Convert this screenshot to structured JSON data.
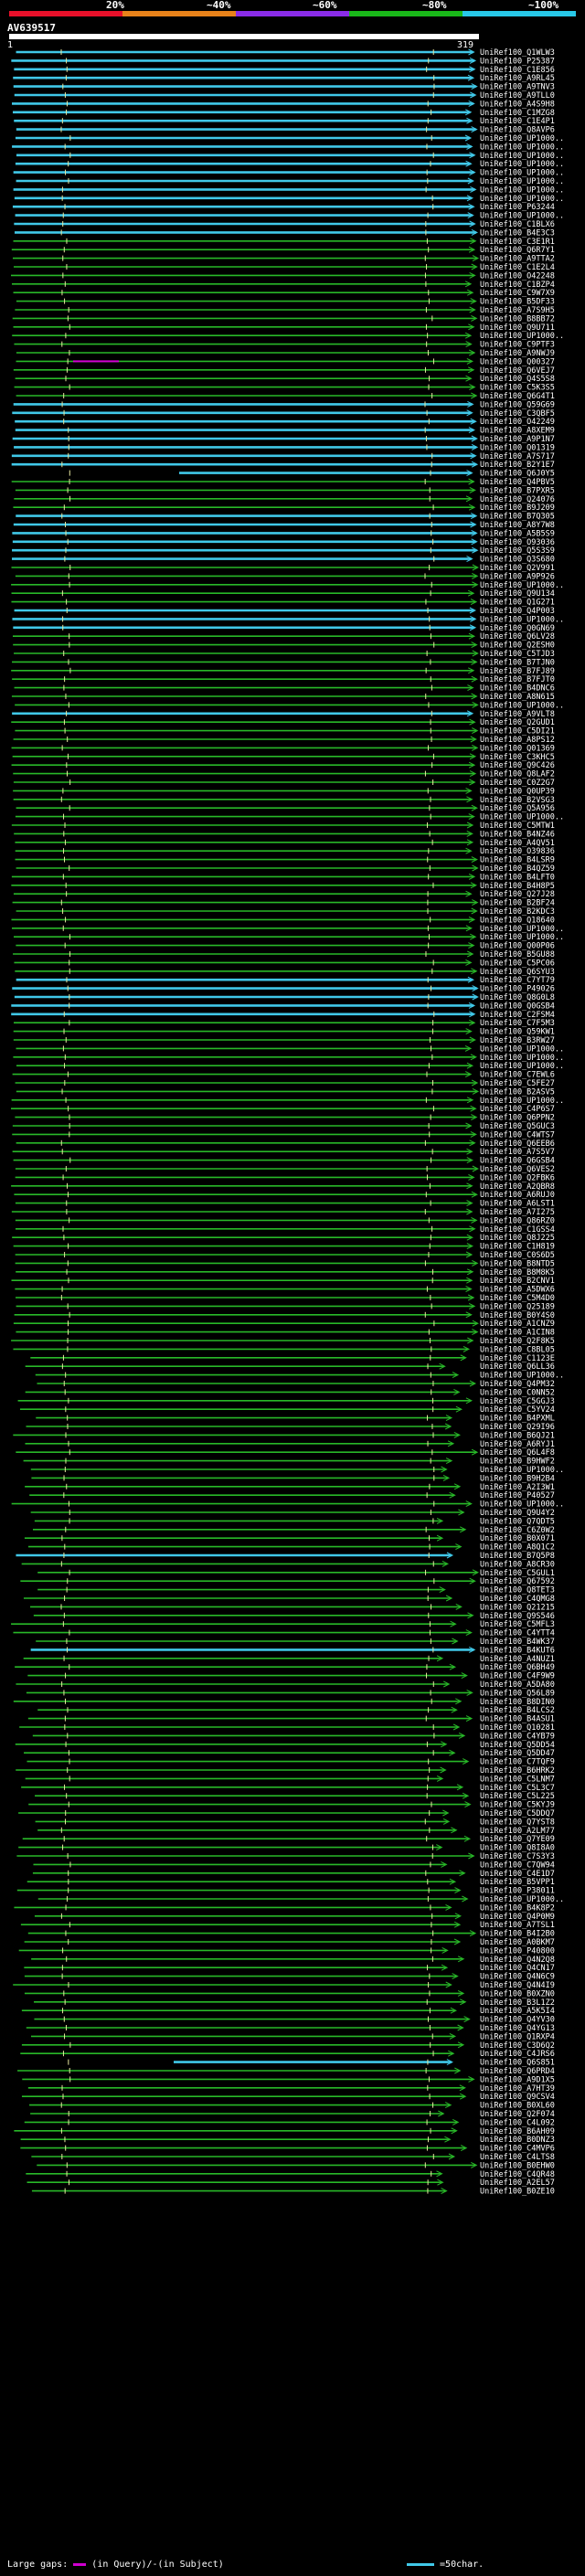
{
  "legend": {
    "percent_labels": [
      "20%",
      "~40%",
      "~60%",
      "~80%",
      "~100%"
    ],
    "colors": [
      "#e8102a",
      "#e8821a",
      "#8a2ce8",
      "#19b819",
      "#28c8e8"
    ]
  },
  "query": {
    "id": "AV639517",
    "start": "1",
    "end": "319"
  },
  "hit_colors": {
    "high": "#40c8e8",
    "mid": "#28b828",
    "gap": "#d000d0",
    "marker": "#e8e8a0"
  },
  "hits": [
    "UniRef100_Q1WLW3",
    "UniRef100_P25387",
    "UniRef100_C1E856",
    "UniRef100_A9RL45",
    "UniRef100_A9TNV3",
    "UniRef100_A9TLL0",
    "UniRef100_A4S9H8",
    "UniRef100_C1MZG8",
    "UniRef100_C1E4P1",
    "UniRef100_Q8AVP6",
    "UniRef100_UP1000..",
    "UniRef100_UP1000..",
    "UniRef100_UP1000..",
    "UniRef100_UP1000..",
    "UniRef100_UP1000..",
    "UniRef100_UP1000..",
    "UniRef100_UP1000..",
    "UniRef100_UP1000..",
    "UniRef100_P63244",
    "UniRef100_UP1000..",
    "UniRef100_C1BLX6",
    "UniRef100_B4E3C3",
    "UniRef100_C3E1R1",
    "UniRef100_Q6R7Y1",
    "UniRef100_A9TTA2",
    "UniRef100_C1E2L4",
    "UniRef100_O42248",
    "UniRef100_C1BZP4",
    "UniRef100_C9W7X9",
    "UniRef100_B5DF33",
    "UniRef100_A7S9H5",
    "UniRef100_B8BB72",
    "UniRef100_Q9U711",
    "UniRef100_UP1000..",
    "UniRef100_C9PTF3",
    "UniRef100_A9NWJ9",
    "UniRef100_Q00327",
    "UniRef100_Q6VEJ7",
    "UniRef100_Q4S5S8",
    "UniRef100_C5K3S5",
    "UniRef100_Q6G4T1",
    "UniRef100_Q59G69",
    "UniRef100_C3QBF5",
    "UniRef100_O42249",
    "UniRef100_A8XEM9",
    "UniRef100_A9P1N7",
    "UniRef100_Q01319",
    "UniRef100_A7S717",
    "UniRef100_B2Y1E7",
    "UniRef100_Q6J0Y5",
    "UniRef100_Q4PBV5",
    "UniRef100_B7PXR5",
    "UniRef100_Q24076",
    "UniRef100_B9J209",
    "UniRef100_B7Q305",
    "UniRef100_A8Y7W8",
    "UniRef100_A5B5S9",
    "UniRef100_O93036",
    "UniRef100_Q5S3S9",
    "UniRef100_Q3S680",
    "UniRef100_Q2V991",
    "UniRef100_A9P926",
    "UniRef100_UP1000..",
    "UniRef100_Q9U134",
    "UniRef100_Q1G271",
    "UniRef100_Q4P003",
    "UniRef100_UP1000..",
    "UniRef100_Q0GN69",
    "UniRef100_Q6LV28",
    "UniRef100_Q2ESH0",
    "UniRef100_C5TJD3",
    "UniRef100_B7TJN0",
    "UniRef100_B7FJ89",
    "UniRef100_B7FJT0",
    "UniRef100_B4DNC6",
    "UniRef100_A8N615",
    "UniRef100_UP1000..",
    "UniRef100_A9VLT8",
    "UniRef100_Q2GUD1",
    "UniRef100_C5DI21",
    "UniRef100_A8PS12",
    "UniRef100_Q01369",
    "UniRef100_C3KHC5",
    "UniRef100_Q9C426",
    "UniRef100_Q8LAF2",
    "UniRef100_C0Z2G7",
    "UniRef100_Q0UP39",
    "UniRef100_B2VSG3",
    "UniRef100_Q5A956",
    "UniRef100_UP1000..",
    "UniRef100_C5MTW1",
    "UniRef100_B4NZ46",
    "UniRef100_A4QV51",
    "UniRef100_O39836",
    "UniRef100_B4LSR9",
    "UniRef100_B4QZ59",
    "UniRef100_B4LFT0",
    "UniRef100_B4H8P5",
    "UniRef100_Q27J28",
    "UniRef100_B2BF24",
    "UniRef100_B2KDC3",
    "UniRef100_Q18640",
    "UniRef100_UP1000..",
    "UniRef100_UP1000..",
    "UniRef100_Q00P06",
    "UniRef100_B5GU88",
    "UniRef100_C5PC06",
    "UniRef100_Q6SYU3",
    "UniRef100_C7YT79",
    "UniRef100_P49026",
    "UniRef100_Q8G0L8",
    "UniRef100_Q0GSB4",
    "UniRef100_C2FSM4",
    "UniRef100_C7F5M3",
    "UniRef100_Q59KW1",
    "UniRef100_B3RW27",
    "UniRef100_UP1000..",
    "UniRef100_UP1000..",
    "UniRef100_UP1000..",
    "UniRef100_C7EWL6",
    "UniRef100_C5FE27",
    "UniRef100_B2ASV5",
    "UniRef100_UP1000..",
    "UniRef100_C4P6S7",
    "UniRef100_Q6PPN2",
    "UniRef100_Q5GUC3",
    "UniRef100_C4WTS7",
    "UniRef100_Q6EEB6",
    "UniRef100_A7S5V7",
    "UniRef100_Q6GSB4",
    "UniRef100_Q6VES2",
    "UniRef100_Q2FBK6",
    "UniRef100_A2QBR8",
    "UniRef100_A6RUJ0",
    "UniRef100_A6LST1",
    "UniRef100_A7I275",
    "UniRef100_Q86RZ0",
    "UniRef100_C1GSS4",
    "UniRef100_Q8J225",
    "UniRef100_C1H819",
    "UniRef100_C0S6D5",
    "UniRef100_B8NTD5",
    "UniRef100_B8M8K5",
    "UniRef100_B2CNV1",
    "UniRef100_A5DWX6",
    "UniRef100_C5M4D0",
    "UniRef100_Q25189",
    "UniRef100_B0Y4S0",
    "UniRef100_A1CNZ9",
    "UniRef100_A1CIN8",
    "UniRef100_Q2F8K5",
    "UniRef100_C8BL05",
    "UniRef100_C1123E",
    "UniRef100_Q6LL36",
    "UniRef100_UP1000..",
    "UniRef100_Q4PM32",
    "UniRef100_C0NN52",
    "UniRef100_C5GGJ3",
    "UniRef100_C5YV24",
    "UniRef100_B4PXML",
    "UniRef100_Q29I96",
    "UniRef100_B6QJ21",
    "UniRef100_A6RYJ1",
    "UniRef100_Q6L4F8",
    "UniRef100_B9HWF2",
    "UniRef100_UP1000..",
    "UniRef100_B9H2B4",
    "UniRef100_A2I3W1",
    "UniRef100_P40527",
    "UniRef100_UP1000..",
    "UniRef100_Q9U4Y2",
    "UniRef100_Q7QDT5",
    "UniRef100_C6Z0W2",
    "UniRef100_B0X071",
    "UniRef100_A8Q1C2",
    "UniRef100_B7Q5P8",
    "UniRef100_A8CR30",
    "UniRef100_C5GUL1",
    "UniRef100_Q67592",
    "UniRef100_Q8TET3",
    "UniRef100_C4QMG8",
    "UniRef100_Q21215",
    "UniRef100_Q9S546",
    "UniRef100_C5MFL3",
    "UniRef100_C4YTT4",
    "UniRef100_B4WK37",
    "UniRef100_B4KUT6",
    "UniRef100_A4NUZ1",
    "UniRef100_Q6BH49",
    "UniRef100_C4F9W9",
    "UniRef100_A5DA80",
    "UniRef100_Q56L89",
    "UniRef100_B8DIN0",
    "UniRef100_B4LCS2",
    "UniRef100_B4ASU1",
    "UniRef100_Q10281",
    "UniRef100_C4YB79",
    "UniRef100_Q5DD54",
    "UniRef100_Q5DD47",
    "UniRef100_C7TQF9",
    "UniRef100_B6HRK2",
    "UniRef100_C5LNM7",
    "UniRef100_C5L3C7",
    "UniRef100_C5L225",
    "UniRef100_C5KYJ9",
    "UniRef100_C5DDQ7",
    "UniRef100_Q7YST8",
    "UniRef100_A2LM77",
    "UniRef100_Q7YE09",
    "UniRef100_Q8I8A0",
    "UniRef100_C7S3Y3",
    "UniRef100_C7QW94",
    "UniRef100_C4E1D7",
    "UniRef100_B5VPP1",
    "UniRef100_P38011",
    "UniRef100_UP1000..",
    "UniRef100_B4K8P2",
    "UniRef100_Q4P0M9",
    "UniRef100_A7TSL1",
    "UniRef100_B4I2B0",
    "UniRef100_A0BKM7",
    "UniRef100_P40800",
    "UniRef100_Q4N2Q8",
    "UniRef100_Q4CN17",
    "UniRef100_Q4N6C9",
    "UniRef100_Q4N4I9",
    "UniRef100_B0XZN0",
    "UniRef100_B3L1Z2",
    "UniRef100_A5K5I4",
    "UniRef100_Q4YV30",
    "UniRef100_Q4YG13",
    "UniRef100_Q1RXP4",
    "UniRef100_C3D6Q2",
    "UniRef100_C4JRS6",
    "UniRef100_Q6S851",
    "UniRef100_Q6PRD4",
    "UniRef100_A9D1X5",
    "UniRef100_A7HT39",
    "UniRef100_Q9CSV4",
    "UniRef100_B0XL60",
    "UniRef100_Q2F074",
    "UniRef100_C4L092",
    "UniRef100_B6AH09",
    "UniRef100_B0DNZ3",
    "UniRef100_C4MVP6",
    "UniRef100_C4LTS8",
    "UniRef100_B0EHW0",
    "UniRef100_C4QR48",
    "UniRef100_A2EL57",
    "UniRef100_B0ZE10"
  ],
  "footer": {
    "gaps_label": "Large gaps:",
    "in_query": "(in Query)/",
    "in_subject": "-(in Subject)",
    "scale_label": "=50char."
  }
}
